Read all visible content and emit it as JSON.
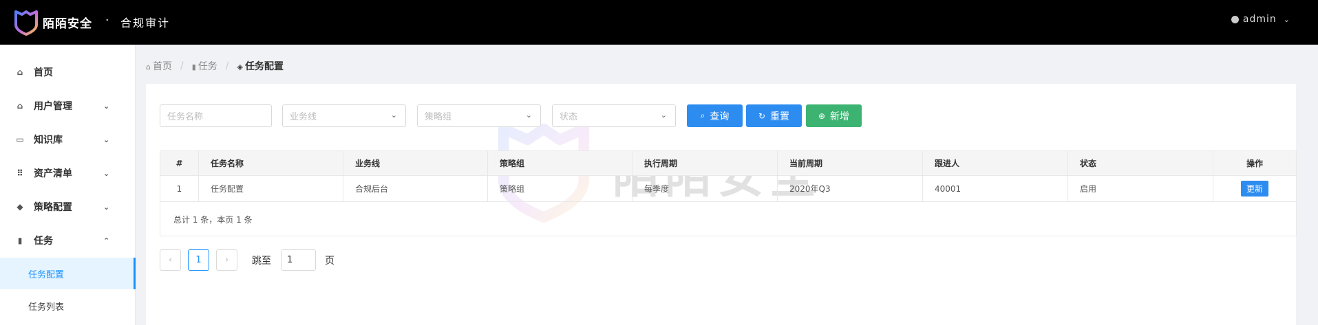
{
  "header": {
    "brand": "陌陌安全",
    "dot": "·",
    "subtitle": "合规审计",
    "user": "admin",
    "brand_colors": [
      "#4f7df9",
      "#c86dd7",
      "#f5c542"
    ]
  },
  "sidebar": {
    "items": [
      {
        "label": "首页",
        "icon": "home-icon",
        "arrow": ""
      },
      {
        "label": "用户管理",
        "icon": "home-icon",
        "arrow": "⌄"
      },
      {
        "label": "知识库",
        "icon": "book-icon",
        "arrow": "⌄"
      },
      {
        "label": "资产清单",
        "icon": "grid-icon",
        "arrow": "⌄"
      },
      {
        "label": "策略配置",
        "icon": "cube-icon",
        "arrow": "⌄"
      },
      {
        "label": "任务",
        "icon": "bar-chart-icon",
        "arrow": "⌃"
      }
    ],
    "sub_items": [
      {
        "label": "任务配置",
        "active": true
      },
      {
        "label": "任务列表",
        "active": false
      }
    ]
  },
  "breadcrumb": {
    "home": "首页",
    "task": "任务",
    "current": "任务配置"
  },
  "filters": {
    "task_name_placeholder": "任务名称",
    "business_line_placeholder": "业务线",
    "policy_group_placeholder": "策略组",
    "status_placeholder": "状态"
  },
  "buttons": {
    "query": "查询",
    "reset": "重置",
    "add": "新增"
  },
  "watermark": "陌陌安全",
  "table": {
    "headers": [
      "#",
      "任务名称",
      "业务线",
      "策略组",
      "执行周期",
      "当前周期",
      "跟进人",
      "状态",
      "操作"
    ],
    "rows": [
      {
        "index": "1",
        "name": "任务配置",
        "business_line": "合规后台",
        "policy_group": "策略组",
        "cycle": "每季度",
        "current_cycle": "2020年Q3",
        "follower": "40001",
        "status": "启用",
        "action": "更新"
      }
    ],
    "footer": "总计 1 条，本页 1 条"
  },
  "pagination": {
    "prev": "‹",
    "page": "1",
    "next": "›",
    "jump_label": "跳至",
    "jump_value": "1",
    "page_suffix": "页"
  }
}
